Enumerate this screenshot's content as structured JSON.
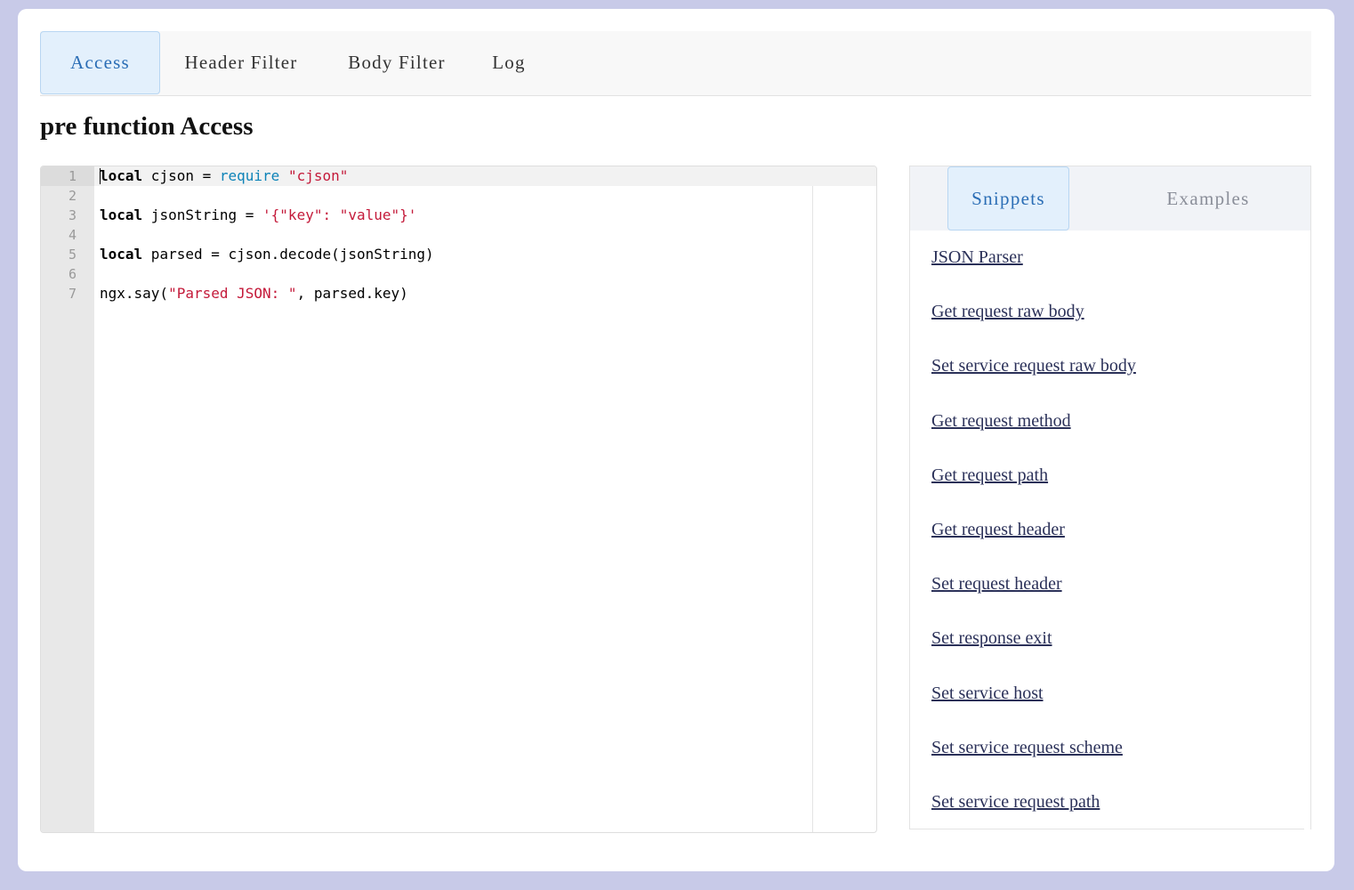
{
  "tabs": [
    "Access",
    "Header Filter",
    "Body Filter",
    "Log"
  ],
  "page_title": "pre function Access",
  "editor": {
    "line_numbers": [
      "1",
      "2",
      "3",
      "4",
      "5",
      "6",
      "7"
    ],
    "lines": {
      "l1": {
        "kw": "local",
        "t1": " cjson = ",
        "fn": "require",
        "t2": " ",
        "str": "\"cjson\""
      },
      "l3": {
        "kw": "local",
        "t1": " jsonString = ",
        "str": "'{\"key\": \"value\"}'"
      },
      "l5": {
        "kw": "local",
        "t1": " parsed = cjson.decode(jsonString)"
      },
      "l7": {
        "t1": "ngx.say(",
        "str": "\"Parsed JSON: \"",
        "t2": ", parsed.key)"
      }
    }
  },
  "side_panel": {
    "tabs": [
      "Snippets",
      "Examples"
    ],
    "snippets": [
      "JSON Parser",
      "Get request raw body",
      "Set service request raw body",
      "Get request method",
      "Get request path",
      "Get request header",
      "Set request header",
      "Set response exit",
      "Set service host",
      "Set service request scheme",
      "Set service request path"
    ]
  }
}
